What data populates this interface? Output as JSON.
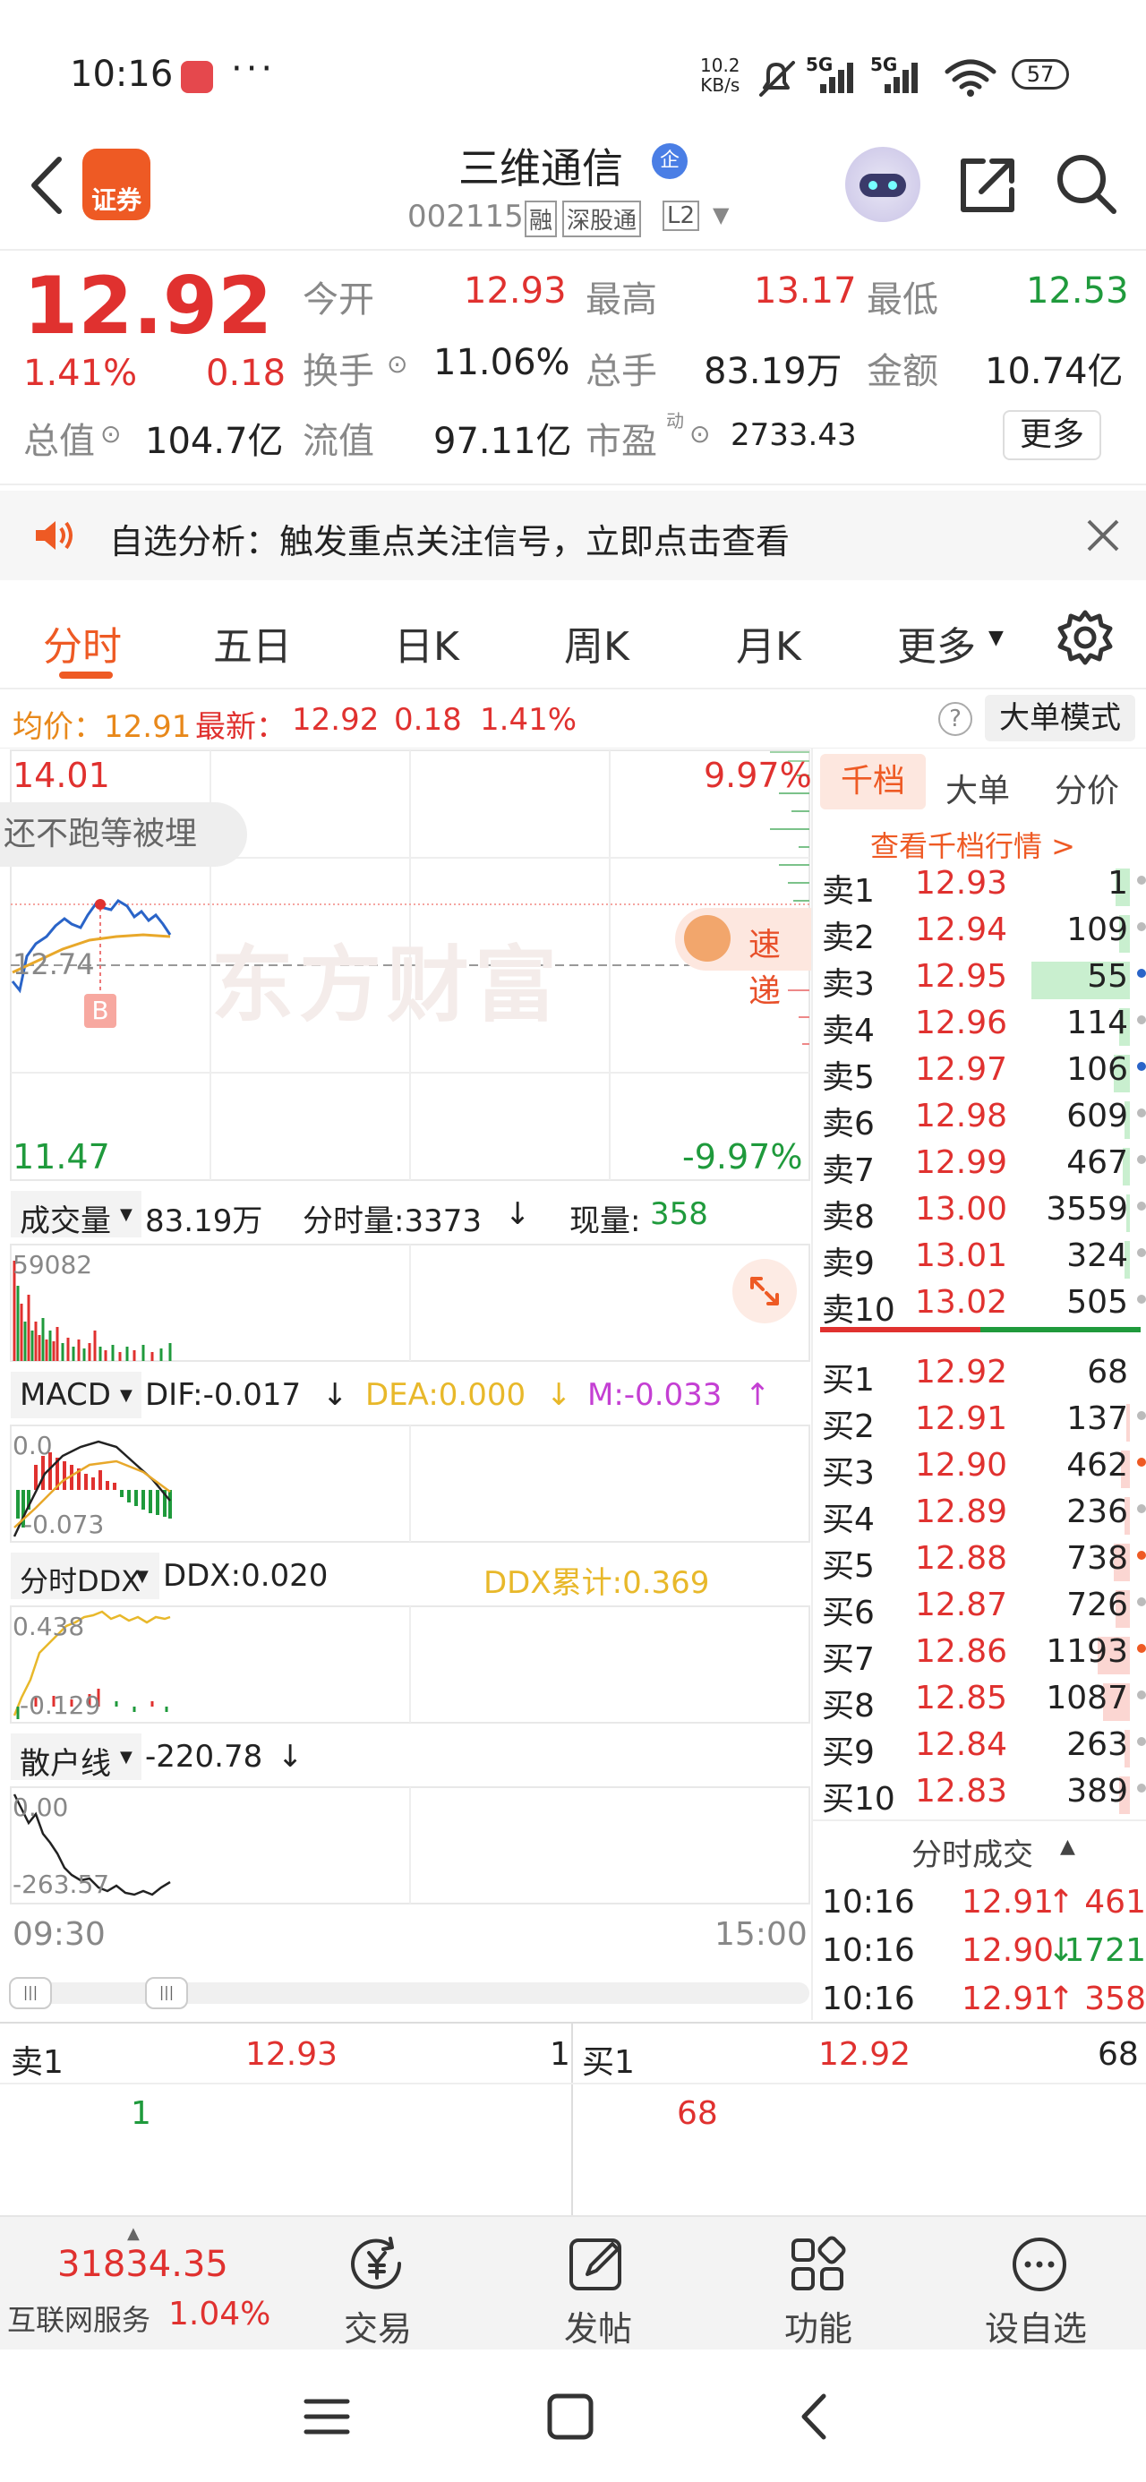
{
  "status_bar": {
    "time": "10:16",
    "speed": "10.2",
    "speed_unit": "KB/s",
    "net1": "5G",
    "net2": "5G",
    "battery": "57"
  },
  "header": {
    "title": "三维通信",
    "title_badge": "企",
    "code": "002115",
    "tags": [
      "融",
      "深股通",
      "L2"
    ],
    "logo_text": "证券"
  },
  "quote": {
    "price": "12.92",
    "change_pct": "1.41%",
    "change": "0.18",
    "open_label": "今开",
    "open": "12.93",
    "high_label": "最高",
    "high": "13.17",
    "low_label": "最低",
    "low": "12.53",
    "turnover_label": "换手",
    "turnover": "11.06%",
    "volume_label": "总手",
    "volume": "83.19万",
    "amount_label": "金额",
    "amount": "10.74亿",
    "mktcap_label": "总值",
    "mktcap": "104.7亿",
    "float_label": "流值",
    "float": "97.11亿",
    "pe_label": "市盈",
    "pe_sup": "动",
    "pe": "2733.43",
    "more": "更多"
  },
  "banner": {
    "text": "自选分析：触发重点关注信号，立即点击查看"
  },
  "tabs": [
    {
      "label": "分时",
      "active": true
    },
    {
      "label": "五日"
    },
    {
      "label": "日K"
    },
    {
      "label": "周K"
    },
    {
      "label": "月K"
    },
    {
      "label": "更多"
    }
  ],
  "chart_info": {
    "avg_label": "均价：12.91",
    "latest_label": "最新：",
    "latest": "12.92",
    "change": "0.18",
    "pct": "1.41%",
    "mode": "大单模式"
  },
  "main_chart": {
    "top_price": "14.01",
    "top_pct": "9.97%",
    "bottom_price": "11.47",
    "bottom_pct": "-9.97%",
    "ref_price": "12.74",
    "overlay": "还不跑等被埋",
    "watermark": "东方财富",
    "speed_label": "速递",
    "buy_marker": "B"
  },
  "volume_panel": {
    "label": "成交量",
    "total": "83.19万",
    "minute_vol": "分时量:3373",
    "current_vol_label": "现量:",
    "current_vol": "358",
    "max": "59082"
  },
  "macd_panel": {
    "label": "MACD",
    "dif": "DIF:-0.017",
    "dea": "DEA:0.000",
    "m": "M:-0.033",
    "top": "0.0",
    "bottom": "-0.073"
  },
  "ddx_panel": {
    "label": "分时DDX",
    "ddx": "DDX:0.020",
    "ddx_sum": "DDX累计:0.369",
    "top": "0.438",
    "bottom": "-0.129"
  },
  "retail_panel": {
    "label": "散户线",
    "value": "-220.78",
    "top": "0.00",
    "bottom": "-263.57"
  },
  "time_axis": {
    "start": "09:30",
    "end": "15:00"
  },
  "orderbook": {
    "tabs": [
      "千档",
      "大单",
      "分价"
    ],
    "link": "查看千档行情 >",
    "asks": [
      {
        "label": "卖10",
        "price": "13.02",
        "vol": "505"
      },
      {
        "label": "卖9",
        "price": "13.01",
        "vol": "324"
      },
      {
        "label": "卖8",
        "price": "13.00",
        "vol": "3559"
      },
      {
        "label": "卖7",
        "price": "12.99",
        "vol": "467"
      },
      {
        "label": "卖6",
        "price": "12.98",
        "vol": "609"
      },
      {
        "label": "卖5",
        "price": "12.97",
        "vol": "106"
      },
      {
        "label": "卖4",
        "price": "12.96",
        "vol": "114"
      },
      {
        "label": "卖3",
        "price": "12.95",
        "vol": "55"
      },
      {
        "label": "卖2",
        "price": "12.94",
        "vol": "109"
      },
      {
        "label": "卖1",
        "price": "12.93",
        "vol": "1"
      }
    ],
    "bids": [
      {
        "label": "买1",
        "price": "12.92",
        "vol": "68"
      },
      {
        "label": "买2",
        "price": "12.91",
        "vol": "137"
      },
      {
        "label": "买3",
        "price": "12.90",
        "vol": "462"
      },
      {
        "label": "买4",
        "price": "12.89",
        "vol": "236"
      },
      {
        "label": "买5",
        "price": "12.88",
        "vol": "738"
      },
      {
        "label": "买6",
        "price": "12.87",
        "vol": "726"
      },
      {
        "label": "买7",
        "price": "12.86",
        "vol": "1193"
      },
      {
        "label": "买8",
        "price": "12.85",
        "vol": "1087"
      },
      {
        "label": "买9",
        "price": "12.84",
        "vol": "263"
      },
      {
        "label": "买10",
        "price": "12.83",
        "vol": "389"
      }
    ],
    "trades_title": "分时成交",
    "trades": [
      {
        "time": "10:16",
        "price": "12.91",
        "dir": "↑",
        "vol": "461"
      },
      {
        "time": "10:16",
        "price": "12.90",
        "dir": "↓",
        "vol": "1721"
      },
      {
        "time": "10:16",
        "price": "12.91",
        "dir": "↑",
        "vol": "358"
      }
    ]
  },
  "bottom": {
    "ask_label": "卖1",
    "ask_price": "12.93",
    "ask_vol": "1",
    "bid_label": "买1",
    "bid_price": "12.92",
    "bid_vol": "68",
    "ask_count": "1",
    "bid_count": "68"
  },
  "footer": {
    "index_value": "31834.35",
    "index_name": "互联网服务",
    "index_pct": "1.04%",
    "items": [
      "交易",
      "发帖",
      "功能",
      "设自选"
    ]
  },
  "colors": {
    "up": "#e0312f",
    "down": "#1f9a3c",
    "accent": "#ee5a24"
  }
}
